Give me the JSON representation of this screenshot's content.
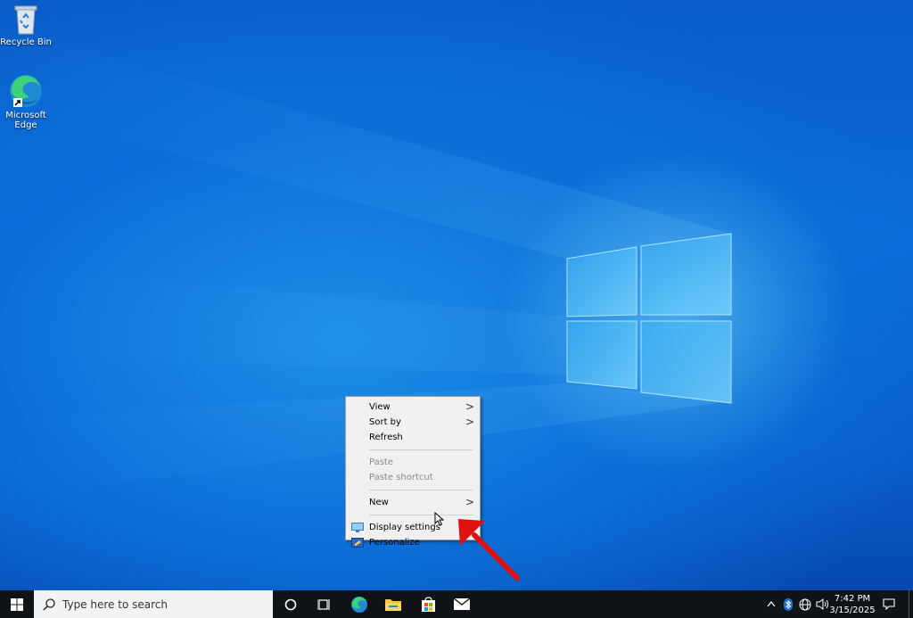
{
  "desktop": {
    "icons": [
      {
        "label": "Recycle Bin",
        "icon": "recycle-bin-icon"
      },
      {
        "label": "Microsoft Edge",
        "label_line1": "Microsoft",
        "label_line2": "Edge",
        "icon": "edge-icon"
      }
    ]
  },
  "context_menu": {
    "items": [
      {
        "label": "View",
        "has_submenu": true,
        "enabled": true
      },
      {
        "label": "Sort by",
        "has_submenu": true,
        "enabled": true
      },
      {
        "label": "Refresh",
        "enabled": true
      },
      {
        "label": "Paste",
        "enabled": false
      },
      {
        "label": "Paste shortcut",
        "enabled": false
      },
      {
        "label": "New",
        "has_submenu": true,
        "enabled": true
      },
      {
        "label": "Display settings",
        "icon": "display-settings-icon",
        "enabled": true
      },
      {
        "label": "Personalize",
        "icon": "personalize-icon",
        "enabled": true
      }
    ],
    "submenu_arrow": ">"
  },
  "taskbar": {
    "search_placeholder": "Type here to search",
    "pinned": [
      "cortana-icon",
      "task-view-icon",
      "edge-icon",
      "file-explorer-icon",
      "store-icon",
      "mail-icon"
    ],
    "tray_icons": [
      "chevron-up-icon",
      "bluetooth-icon",
      "network-icon",
      "volume-icon"
    ],
    "clock": {
      "time": "7:42 PM",
      "date": "3/15/2025"
    }
  },
  "annotation": {
    "color": "#e01010",
    "points_to": "Display settings"
  },
  "colors": {
    "accent": "#0a5fd0",
    "taskbar": "#101418",
    "menu_bg": "#f0f0f0"
  }
}
